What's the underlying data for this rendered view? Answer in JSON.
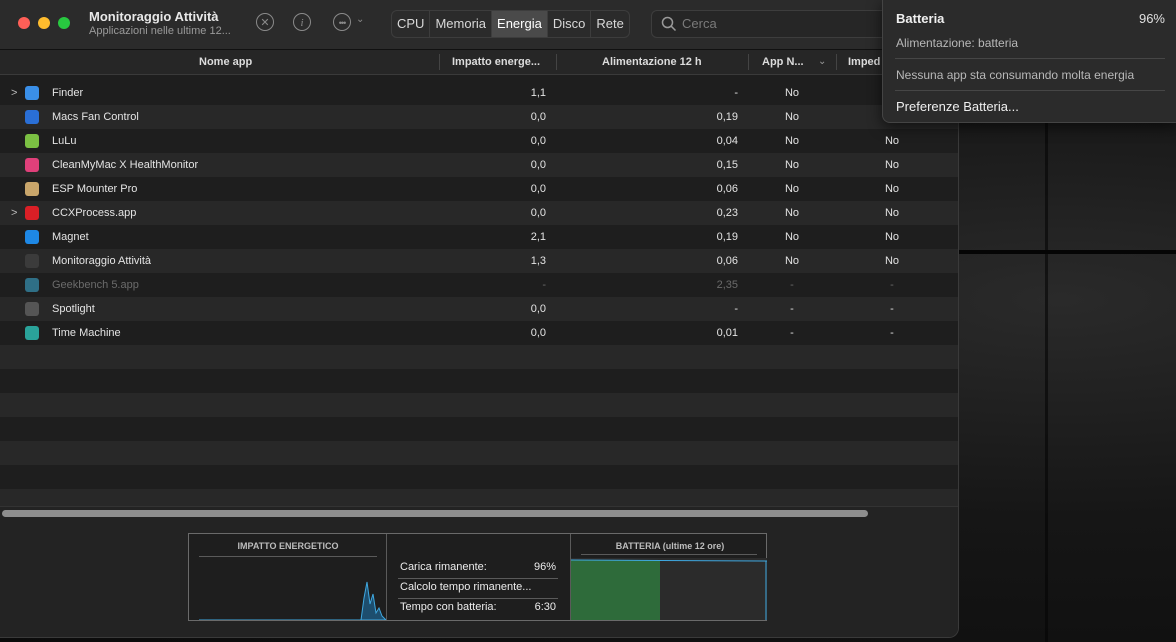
{
  "window": {
    "title": "Monitoraggio Attività",
    "subtitle": "Applicazioni nelle ultime 12..."
  },
  "toolbar": {
    "tabs": [
      "CPU",
      "Memoria",
      "Energia",
      "Disco",
      "Rete"
    ],
    "active_tab": "Energia",
    "search_placeholder": "Cerca"
  },
  "table": {
    "columns": [
      "Nome app",
      "Impatto energe...",
      "Alimentazione 12 h",
      "App N...",
      "Imped"
    ],
    "rows": [
      {
        "name": "Finder",
        "impact": "1,1",
        "power12h": "-",
        "app_nap": "No",
        "prevent": "",
        "expand": ">",
        "icon": "finder-icon",
        "color": "#3a8fe8",
        "dim": false
      },
      {
        "name": "Macs Fan Control",
        "impact": "0,0",
        "power12h": "0,19",
        "app_nap": "No",
        "prevent": "",
        "expand": "",
        "icon": "fan-icon",
        "color": "#2a6fd6",
        "dim": false
      },
      {
        "name": "LuLu",
        "impact": "0,0",
        "power12h": "0,04",
        "app_nap": "No",
        "prevent": "No",
        "expand": "",
        "icon": "shield-icon",
        "color": "#7bc043",
        "dim": false
      },
      {
        "name": "CleanMyMac X HealthMonitor",
        "impact": "0,0",
        "power12h": "0,15",
        "app_nap": "No",
        "prevent": "No",
        "expand": "",
        "icon": "monitor-icon",
        "color": "#e0407a",
        "dim": false
      },
      {
        "name": "ESP Mounter Pro",
        "impact": "0,0",
        "power12h": "0,06",
        "app_nap": "No",
        "prevent": "No",
        "expand": "",
        "icon": "drive-icon",
        "color": "#c9a66b",
        "dim": false
      },
      {
        "name": "CCXProcess.app",
        "impact": "0,0",
        "power12h": "0,23",
        "app_nap": "No",
        "prevent": "No",
        "expand": ">",
        "icon": "creative-cloud-icon",
        "color": "#da1f26",
        "dim": false
      },
      {
        "name": "Magnet",
        "impact": "2,1",
        "power12h": "0,19",
        "app_nap": "No",
        "prevent": "No",
        "expand": "",
        "icon": "magnet-icon",
        "color": "#1e88e5",
        "dim": false
      },
      {
        "name": "Monitoraggio Attività",
        "impact": "1,3",
        "power12h": "0,06",
        "app_nap": "No",
        "prevent": "No",
        "expand": "",
        "icon": "activity-monitor-icon",
        "color": "#3b3b3b",
        "dim": false
      },
      {
        "name": "Geekbench 5.app",
        "impact": "-",
        "power12h": "2,35",
        "app_nap": "-",
        "prevent": "-",
        "expand": "",
        "icon": "geekbench-icon",
        "color": "#2f6f86",
        "dim": true
      },
      {
        "name": "Spotlight",
        "impact": "0,0",
        "power12h": "-",
        "app_nap": "-",
        "prevent": "-",
        "expand": "",
        "icon": "search-icon",
        "color": "#555555",
        "dim": false
      },
      {
        "name": "Time Machine",
        "impact": "0,0",
        "power12h": "0,01",
        "app_nap": "-",
        "prevent": "-",
        "expand": "",
        "icon": "time-machine-icon",
        "color": "#2aa39a",
        "dim": false
      }
    ]
  },
  "bottom_panel": {
    "energy_impact_title": "IMPATTO ENERGETICO",
    "battery_title": "BATTERIA (ultime 12 ore)",
    "stats": [
      {
        "label": "Carica rimanente:",
        "value": "96%"
      },
      {
        "label": "Calcolo tempo rimanente...",
        "value": ""
      },
      {
        "label": "Tempo con batteria:",
        "value": "6:30"
      }
    ],
    "battery_charge_percent": 96,
    "colors": {
      "graph_line": "#3fa8e0",
      "battery_fill": "#2e6b3a"
    }
  },
  "battery_menu": {
    "title": "Batteria",
    "percent": "96%",
    "source": "Alimentazione: batteria",
    "no_apps": "Nessuna app sta consumando molta energia",
    "preferences": "Preferenze Batteria..."
  }
}
